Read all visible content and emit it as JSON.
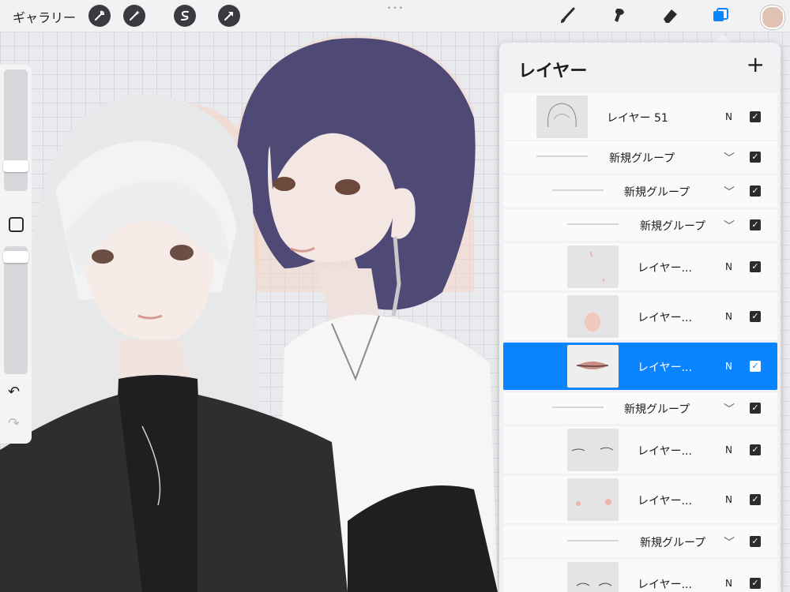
{
  "toolbar": {
    "gallery_label": "ギャラリー",
    "left_tools": [
      "wrench-icon",
      "magic-wand-icon",
      "selection-s-icon",
      "transform-arrow-icon"
    ],
    "right_tools": [
      "brush-icon",
      "smudge-icon",
      "eraser-icon",
      "layers-icon"
    ],
    "active_tool": "layers-icon",
    "color_swatch": "#e0c2b3"
  },
  "sidebar": {
    "undo_icon": "undo-icon",
    "redo_icon": "redo-icon"
  },
  "layers_panel": {
    "title": "レイヤー",
    "add_symbol": "+",
    "rows": [
      {
        "type": "layer",
        "label": "レイヤー 51",
        "blend": "N",
        "visible": true
      },
      {
        "type": "group",
        "label": "新規グループ",
        "visible": true
      },
      {
        "type": "group",
        "label": "新規グループ",
        "visible": true
      },
      {
        "type": "group",
        "label": "新規グループ",
        "visible": true
      },
      {
        "type": "layer",
        "label": "レイヤー...",
        "blend": "N",
        "visible": true
      },
      {
        "type": "layer",
        "label": "レイヤー...",
        "blend": "N",
        "visible": true
      },
      {
        "type": "layer",
        "label": "レイヤー...",
        "blend": "N",
        "visible": true,
        "selected": true
      },
      {
        "type": "group",
        "label": "新規グループ",
        "visible": true
      },
      {
        "type": "layer",
        "label": "レイヤー...",
        "blend": "N",
        "visible": true
      },
      {
        "type": "layer",
        "label": "レイヤー...",
        "blend": "N",
        "visible": true
      },
      {
        "type": "group",
        "label": "新規グループ",
        "visible": true
      },
      {
        "type": "layer",
        "label": "レイヤー...",
        "blend": "N",
        "visible": true
      }
    ],
    "accent_color": "#0a84ff"
  }
}
